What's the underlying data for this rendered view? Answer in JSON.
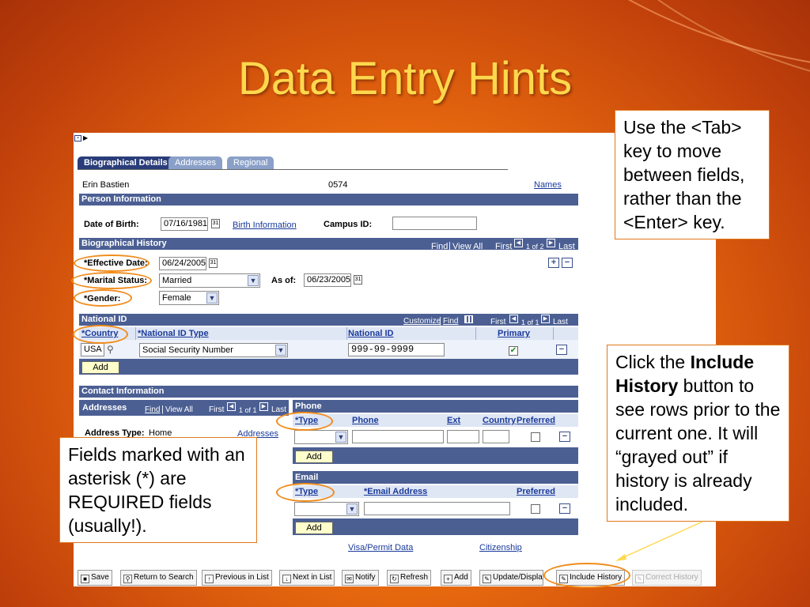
{
  "slide": {
    "title": "Data Entry Hints",
    "callout_tab": "Use the <Tab> key to move between fields, rather than the <Enter> key.",
    "callout_history_pre": "Click the ",
    "callout_history_bold": "Include History",
    "callout_history_post": " button to see rows prior to the current one. It will “grayed out” if history is already included.",
    "callout_required": "Fields marked with an asterisk (*) are REQUIRED fields (usually!)."
  },
  "tabs": [
    "Biographical Details",
    "Addresses",
    "Regional"
  ],
  "person": {
    "name": "Erin Bastien",
    "id": "0574",
    "names_link": "Names"
  },
  "person_info": {
    "header": "Person Information",
    "dob_label": "Date of Birth:",
    "dob": "07/16/1981",
    "birth_link": "Birth Information",
    "campus_label": "Campus ID:"
  },
  "bio": {
    "header": "Biographical History",
    "find": "Find",
    "view_all": "View All",
    "first": "First",
    "of": "1 of 2",
    "last": "Last",
    "eff_label": "*Effective Date:",
    "eff_value": "06/24/2005",
    "marital_label": "*Marital Status:",
    "marital_value": "Married",
    "asof_label": "As of:",
    "asof_value": "06/23/2005",
    "gender_label": "*Gender:",
    "gender_value": "Female"
  },
  "national": {
    "header": "National ID",
    "customize": "Customize",
    "find": "Find",
    "first": "First",
    "of": "1 of 1",
    "last": "Last",
    "col_country": "*Country",
    "col_type": "*National ID Type",
    "col_id": "National ID",
    "col_primary": "Primary",
    "country": "USA",
    "type": "Social Security Number",
    "id": "999-99-9999",
    "add": "Add"
  },
  "contact": {
    "header": "Contact Information",
    "addr_header": "Addresses",
    "find": "Find",
    "view_all": "View All",
    "first": "First",
    "of": "1 of 1",
    "last": "Last",
    "addr_type_label": "Address Type:",
    "addr_type": "Home",
    "addresses_link": "Addresses",
    "phone_header": "Phone",
    "ph_type": "*Type",
    "ph_phone": "Phone",
    "ph_ext": "Ext",
    "ph_country": "Country",
    "ph_pref": "Preferred",
    "add": "Add",
    "email_header": "Email",
    "em_type": "*Type",
    "em_addr": "*Email Address",
    "em_pref": "Preferred",
    "visa": "Visa/Permit Data",
    "citizenship": "Citizenship"
  },
  "toolbar": [
    "Save",
    "Return to Search",
    "Previous in List",
    "Next in List",
    "Notify",
    "Refresh",
    "Add",
    "Update/Display",
    "Include History",
    "Correct History"
  ]
}
